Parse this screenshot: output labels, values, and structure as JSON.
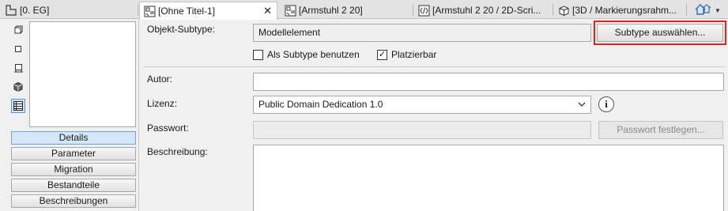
{
  "tabs": [
    {
      "label": "[0. EG]",
      "icon": "floor-plan-icon",
      "active": false
    },
    {
      "label": "[Ohne Titel-1]",
      "icon": "object-editor-icon",
      "active": true,
      "close": "✕"
    },
    {
      "label": "[Armstuhl 2 20]",
      "icon": "object-editor-icon",
      "active": false
    },
    {
      "label": "[Armstuhl 2 20 / 2D-Scri...",
      "icon": "script-icon",
      "active": false
    },
    {
      "label": "[3D / Markierungsrahm...",
      "icon": "3d-cube-icon",
      "active": false
    }
  ],
  "left_panel": {
    "view_icons": [
      "2d-symbol-icon",
      "2d-view-icon",
      "section-view-icon",
      "3d-view-icon",
      "parameters-view-icon"
    ],
    "nav_buttons": [
      "Details",
      "Parameter",
      "Migration",
      "Bestandteile",
      "Beschreibungen"
    ],
    "active_nav": "Details"
  },
  "details": {
    "subtype_label": "Objekt-Subtype:",
    "subtype_value": "Modellelement",
    "subtype_button": "Subtype auswählen...",
    "use_as_subtype_label": "Als Subtype benutzen",
    "use_as_subtype_checked": false,
    "placeable_label": "Platzierbar",
    "placeable_checked": true,
    "author_label": "Autor:",
    "author_value": "",
    "license_label": "Lizenz:",
    "license_value": "Public Domain Dedication 1.0",
    "password_label": "Passwort:",
    "password_button": "Passwort festlegen...",
    "description_label": "Beschreibung:",
    "description_value": "",
    "highlight_color": "#e0201a"
  }
}
